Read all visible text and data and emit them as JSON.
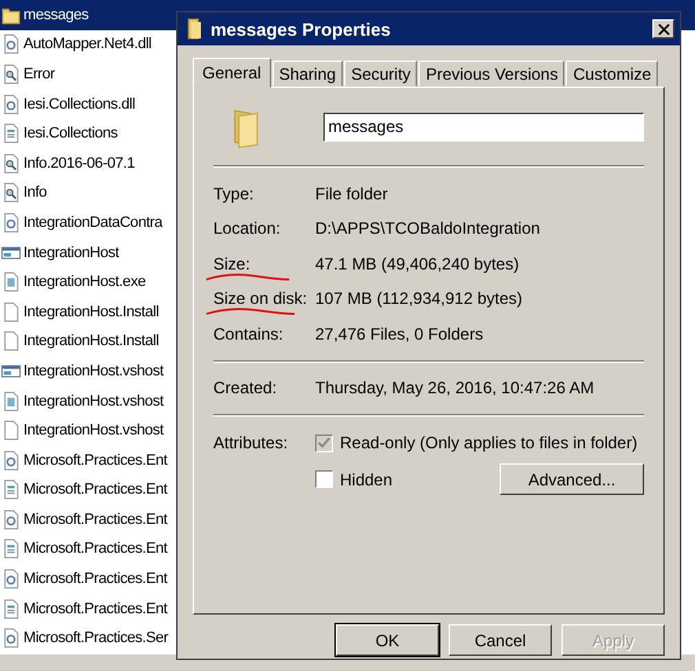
{
  "explorer": {
    "rows": [
      {
        "name": "messages",
        "kind": "folder",
        "selected": true
      },
      {
        "name": "AutoMapper.Net4.dll",
        "kind": "dll",
        "selected": false
      },
      {
        "name": "Error",
        "kind": "log",
        "selected": false
      },
      {
        "name": "Iesi.Collections.dll",
        "kind": "dll",
        "selected": false
      },
      {
        "name": "Iesi.Collections",
        "kind": "config",
        "selected": false
      },
      {
        "name": "Info.2016-06-07.1",
        "kind": "log",
        "selected": false
      },
      {
        "name": "Info",
        "kind": "log",
        "selected": false
      },
      {
        "name": "IntegrationDataContra",
        "kind": "dll",
        "selected": false
      },
      {
        "name": "IntegrationHost",
        "kind": "app",
        "selected": false
      },
      {
        "name": "IntegrationHost.exe",
        "kind": "exe",
        "selected": false
      },
      {
        "name": "IntegrationHost.Install",
        "kind": "blank",
        "selected": false
      },
      {
        "name": "IntegrationHost.Install",
        "kind": "blank",
        "selected": false
      },
      {
        "name": "IntegrationHost.vshost",
        "kind": "app",
        "selected": false
      },
      {
        "name": "IntegrationHost.vshost",
        "kind": "exe",
        "selected": false
      },
      {
        "name": "IntegrationHost.vshost",
        "kind": "blank",
        "selected": false
      },
      {
        "name": "Microsoft.Practices.Ent",
        "kind": "dll",
        "selected": false
      },
      {
        "name": "Microsoft.Practices.Ent",
        "kind": "config",
        "selected": false
      },
      {
        "name": "Microsoft.Practices.Ent",
        "kind": "dll",
        "selected": false
      },
      {
        "name": "Microsoft.Practices.Ent",
        "kind": "config",
        "selected": false
      },
      {
        "name": "Microsoft.Practices.Ent",
        "kind": "dll",
        "selected": false
      },
      {
        "name": "Microsoft.Practices.Ent",
        "kind": "config",
        "selected": false
      },
      {
        "name": "Microsoft.Practices.Ser",
        "kind": "dll",
        "selected": false
      }
    ]
  },
  "dialog": {
    "title": "messages Properties",
    "tabs": [
      {
        "label": "General",
        "selected": true
      },
      {
        "label": "Sharing",
        "selected": false
      },
      {
        "label": "Security",
        "selected": false
      },
      {
        "label": "Previous Versions",
        "selected": false
      },
      {
        "label": "Customize",
        "selected": false
      }
    ],
    "name_field": {
      "value": "messages"
    },
    "sections": [
      [
        {
          "label": "Type:",
          "value": "File folder",
          "underlined": false
        },
        {
          "label": "Location:",
          "value": "D:\\APPS\\TCOBaldoIntegration",
          "underlined": false
        },
        {
          "label": "Size:",
          "value": "47.1 MB (49,406,240 bytes)",
          "underlined": true
        },
        {
          "label": "Size on disk:",
          "value": "107 MB (112,934,912 bytes)",
          "underlined": true
        },
        {
          "label": "Contains:",
          "value": "27,476 Files, 0 Folders",
          "underlined": false
        }
      ],
      [
        {
          "label": "Created:",
          "value": "Thursday, May 26, 2016, 10:47:26 AM",
          "underlined": false
        }
      ]
    ],
    "attributes": {
      "label": "Attributes:",
      "checkboxes": [
        {
          "label": "Read-only (Only applies to files in folder)",
          "checked": true,
          "greyed": true
        },
        {
          "label": "Hidden",
          "checked": false,
          "greyed": false
        }
      ],
      "advanced_button": "Advanced..."
    },
    "buttons": [
      {
        "label": "OK",
        "disabled": false,
        "default": true
      },
      {
        "label": "Cancel",
        "disabled": false,
        "default": false
      },
      {
        "label": "Apply",
        "disabled": true,
        "default": false
      }
    ]
  }
}
